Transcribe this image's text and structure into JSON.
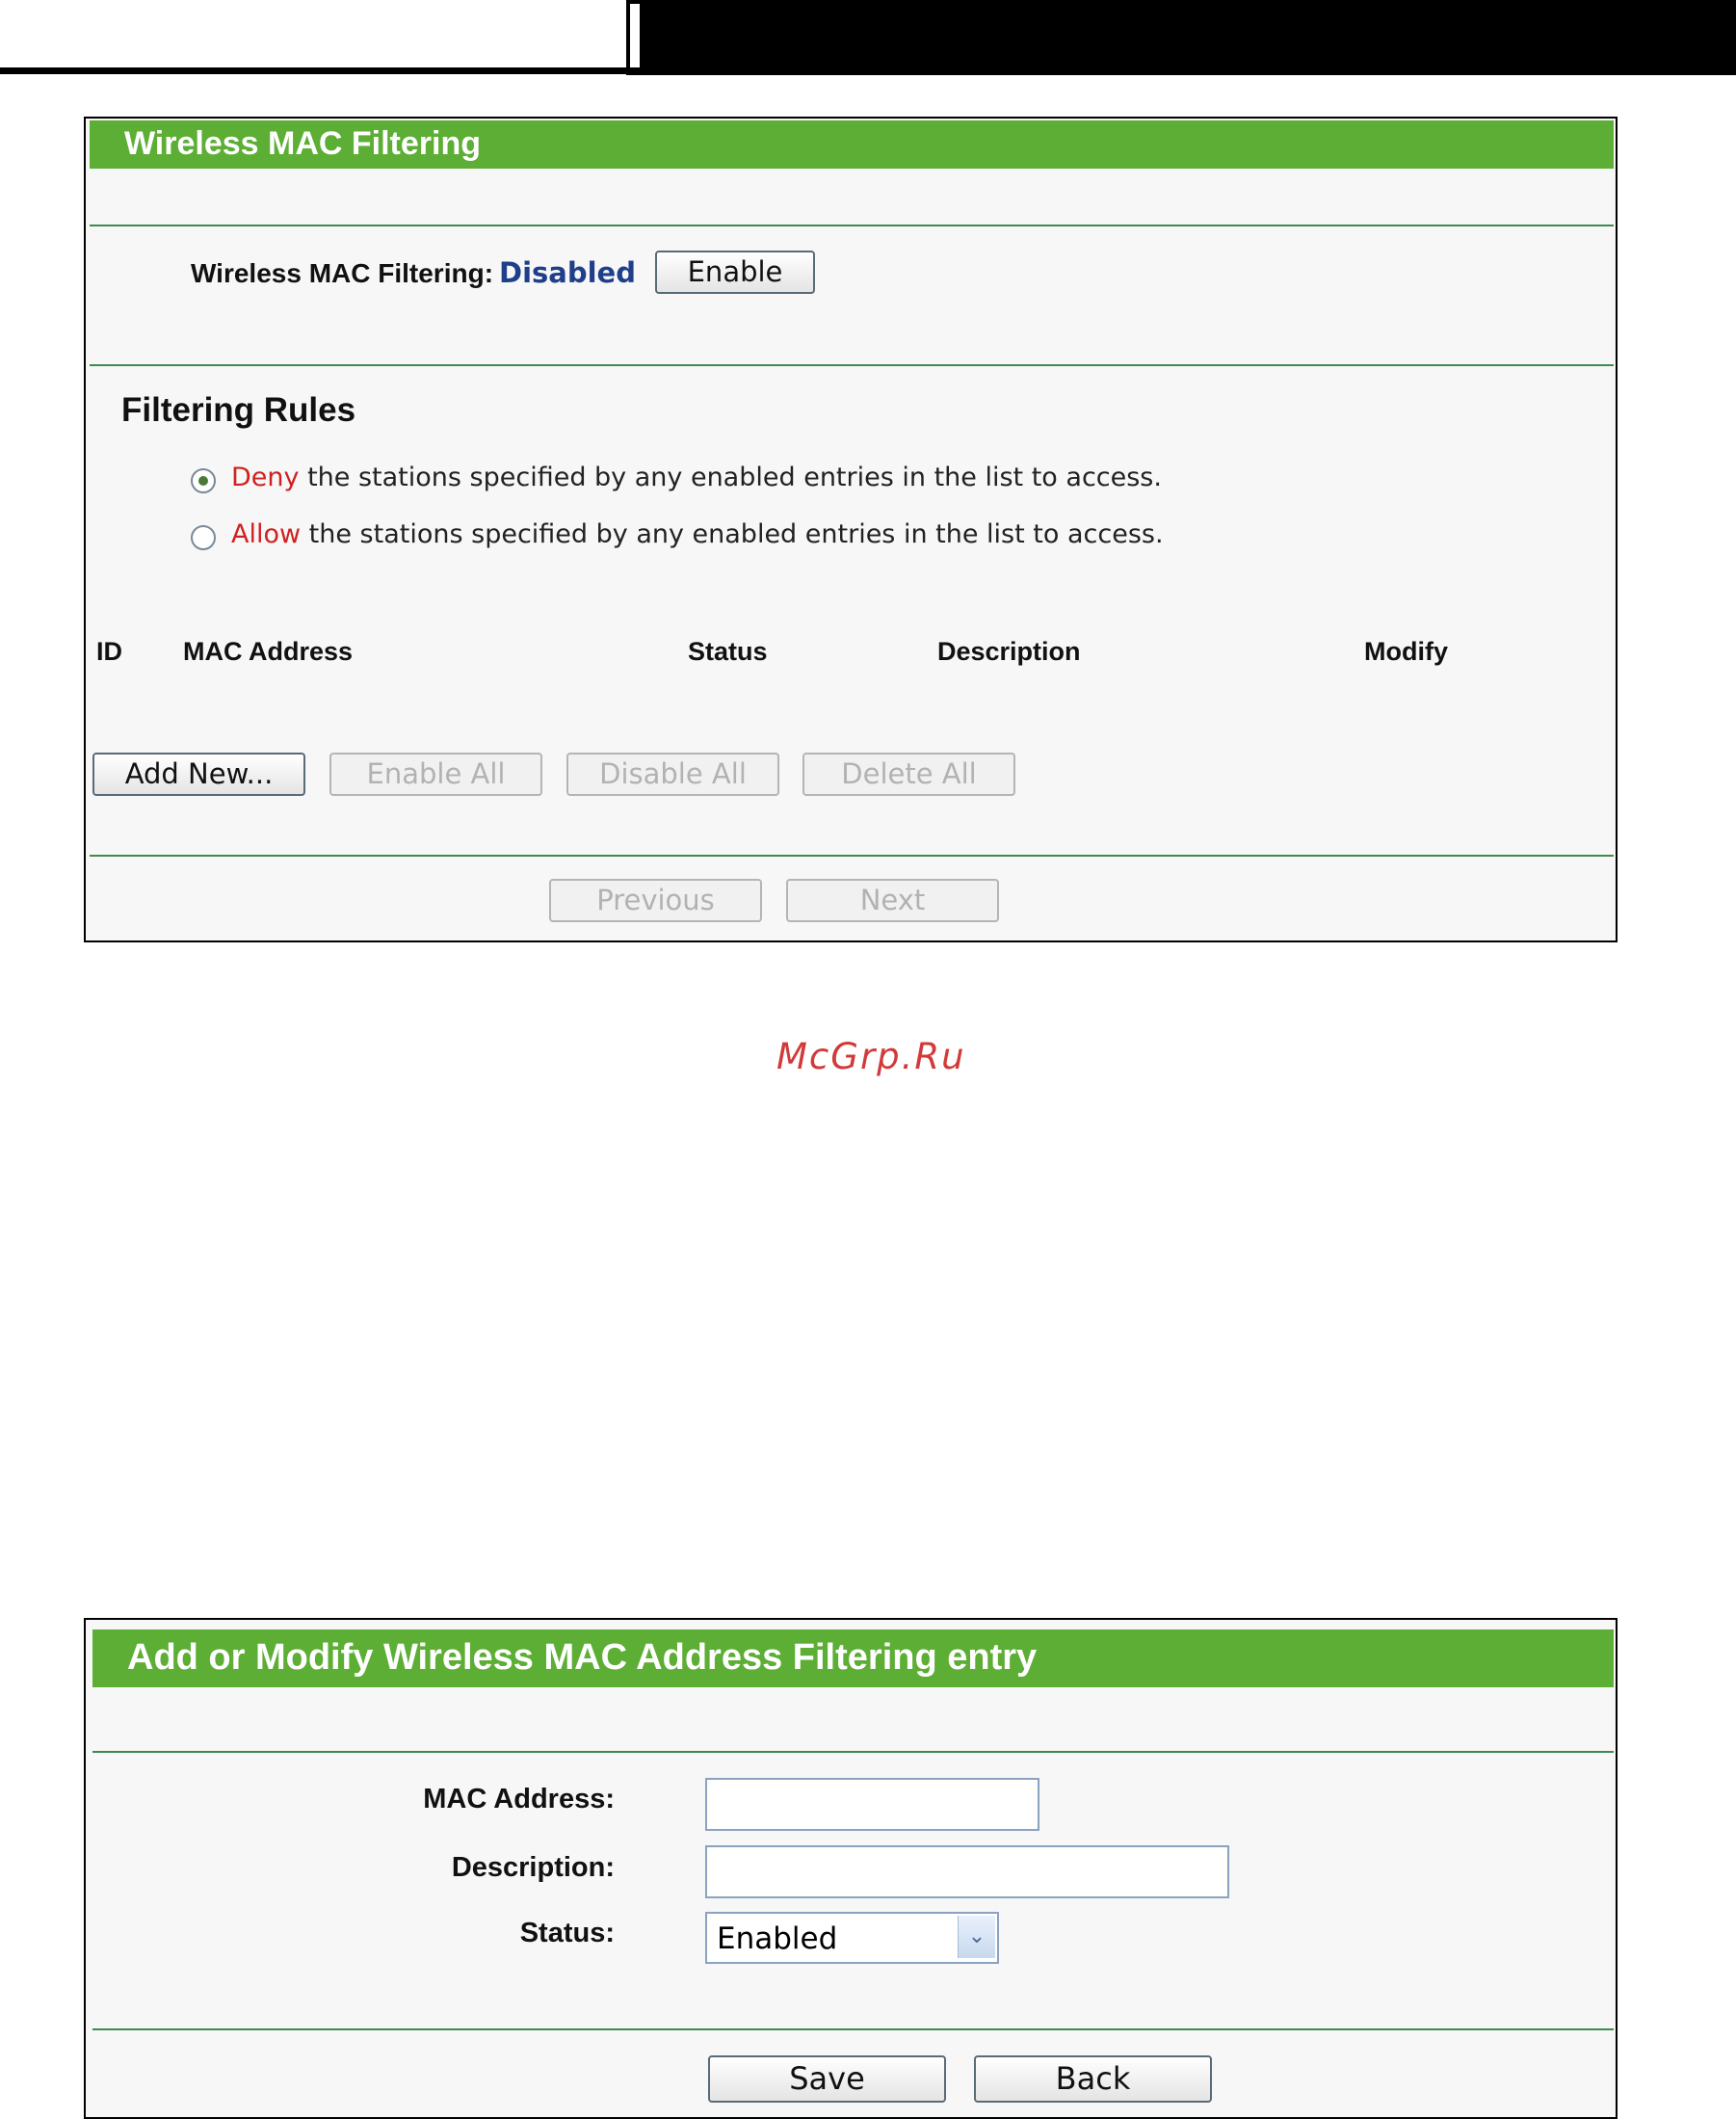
{
  "mac_filter_page": {
    "title": "Wireless MAC Filtering",
    "filter_label": "Wireless MAC Filtering:",
    "filter_status": "Disabled",
    "enable_button": "Enable",
    "rules_title": "Filtering Rules",
    "rules": [
      {
        "keyword": "Deny",
        "text": " the stations specified by any enabled entries in the list to access.",
        "checked": true
      },
      {
        "keyword": "Allow",
        "text": " the stations specified by any enabled entries in the list to access.",
        "checked": false
      }
    ],
    "table_headers": [
      "ID",
      "MAC Address",
      "Status",
      "Description",
      "Modify"
    ],
    "actions": {
      "add_new": "Add New...",
      "enable_all": "Enable All",
      "disable_all": "Disable All",
      "delete_all": "Delete All"
    },
    "pagination": {
      "previous": "Previous",
      "next": "Next"
    }
  },
  "watermark": "McGrp.Ru",
  "entry_page": {
    "title": "Add or Modify Wireless MAC Address Filtering entry",
    "mac_label": "MAC Address:",
    "mac_value": "",
    "description_label": "Description:",
    "description_value": "",
    "status_label": "Status:",
    "status_value": "Enabled",
    "save_button": "Save",
    "back_button": "Back"
  },
  "colors": {
    "header_green": "#5dae35",
    "divider_green": "#3f8a4f",
    "status_blue": "#1f3f8a",
    "rule_keyword_red": "#d02020",
    "watermark_red": "#d23a3a"
  },
  "icons": {
    "radio_checked": "radio-selected-icon",
    "radio_unchecked": "radio-empty-icon",
    "dropdown_arrow": "chevron-down-icon"
  }
}
